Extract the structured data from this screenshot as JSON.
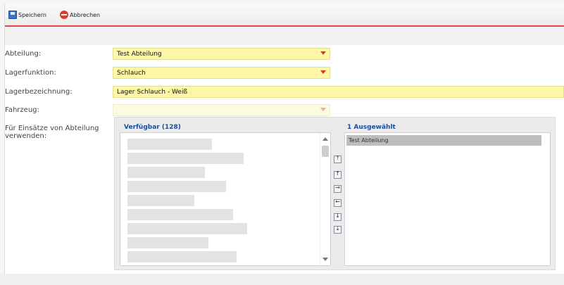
{
  "toolbar": {
    "save_label": "Speichern",
    "cancel_label": "Abbrechen"
  },
  "form": {
    "abteilung": {
      "label": "Abteilung:",
      "value": "Test Abteilung"
    },
    "lagerfunktion": {
      "label": "Lagerfunktion:",
      "value": "Schlauch"
    },
    "lagerbezeichnung": {
      "label": "Lagerbezeichnung:",
      "value": "Lager Schlauch - Weiß"
    },
    "fahrzeug": {
      "label": "Fahrzeug:",
      "value": ""
    },
    "einsaetze": {
      "label_line1": "Für Einsätze von Abteilung",
      "label_line2": "verwenden:"
    }
  },
  "multiselect": {
    "available_header": "Verfügbar (128)",
    "selected_header": "1 Ausgewählt",
    "selected_items": [
      "Test Abteilung"
    ],
    "buttons": {
      "top": "⤒",
      "up": "↑",
      "add": "→",
      "remove": "←",
      "down": "↓",
      "bottom": "⤓"
    }
  },
  "colors": {
    "field_bg": "#fdf7a6",
    "accent_red": "#d94a4a",
    "header_blue": "#1b4d9c"
  }
}
